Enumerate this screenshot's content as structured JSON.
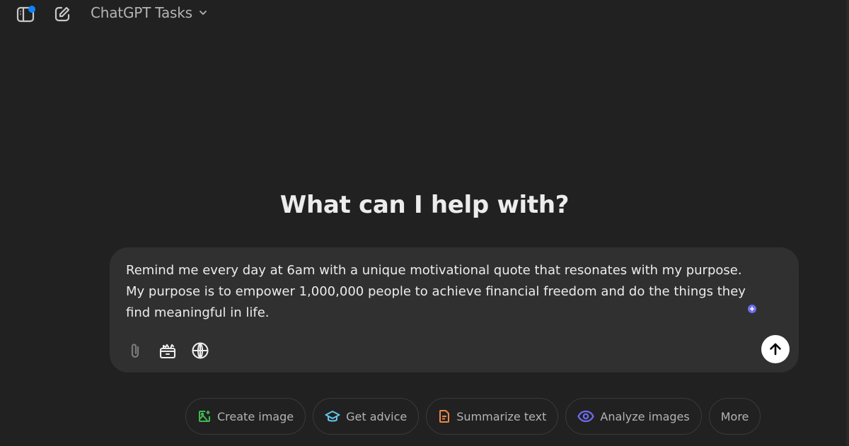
{
  "header": {
    "model_name": "ChatGPT Tasks",
    "sidebar_notification": true
  },
  "main": {
    "heading": "What can I help with?"
  },
  "composer": {
    "value": "Remind me every day at 6am with a unique motivational quote that resonates with my purpose. My purpose is to empower 1,000,000 people to achieve financial freedom and do the things they find meaningful in life.",
    "tools": [
      "attach-icon",
      "toolbox-icon",
      "globe-icon"
    ],
    "send_icon": "arrow-up-icon"
  },
  "suggestions": [
    {
      "label": "Create image",
      "icon": "image-icon",
      "color": "#3fb950"
    },
    {
      "label": "Get advice",
      "icon": "graduation-cap-icon",
      "color": "#63c5e8"
    },
    {
      "label": "Summarize text",
      "icon": "document-icon",
      "color": "#e8884a"
    },
    {
      "label": "Analyze images",
      "icon": "eye-icon",
      "color": "#6d6df4"
    },
    {
      "label": "More",
      "icon": null,
      "color": null
    }
  ],
  "colors": {
    "background": "#212121",
    "composer": "#303030",
    "notification": "#0d84ff"
  }
}
